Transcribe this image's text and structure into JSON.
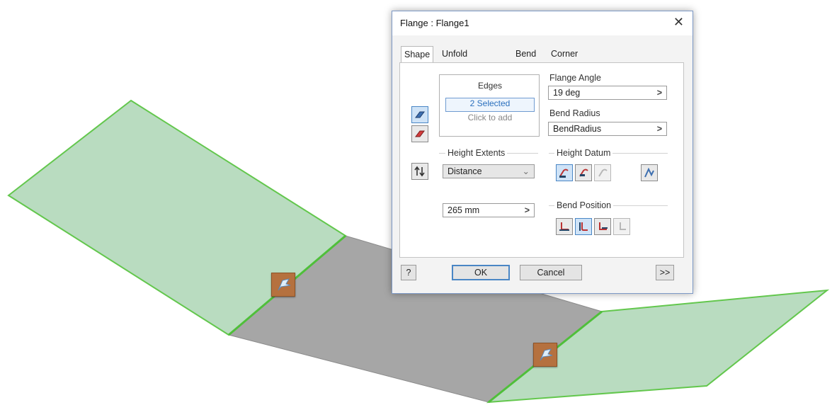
{
  "dialog": {
    "title": "Flange : Flange1",
    "close_glyph": "✕",
    "tabs": [
      {
        "label": "Shape",
        "active": true
      },
      {
        "label": "Unfold Options",
        "active": false
      },
      {
        "label": "Bend",
        "active": false
      },
      {
        "label": "Corner",
        "active": false
      }
    ],
    "edges": {
      "header": "Edges",
      "selected": "2 Selected",
      "click_to_add": "Click to add"
    },
    "flange_angle": {
      "label": "Flange Angle",
      "value": "19 deg",
      "arrow": ">"
    },
    "bend_radius": {
      "label": "Bend Radius",
      "value": "BendRadius",
      "arrow": ">"
    },
    "height_extents": {
      "label": "Height Extents",
      "type_value": "Distance",
      "distance_value": "265 mm",
      "arrow": ">"
    },
    "height_datum": {
      "label": "Height Datum"
    },
    "bend_position": {
      "label": "Bend Position"
    },
    "buttons": {
      "help": "?",
      "ok": "OK",
      "cancel": "Cancel",
      "more": ">>"
    }
  },
  "viewport": {
    "face_colors": {
      "flange": "#b9dcc0",
      "base": "#a3a3a3",
      "edge_highlight": "#63c74d"
    },
    "glyph_icon": "flange-direction-glyph-icon"
  }
}
